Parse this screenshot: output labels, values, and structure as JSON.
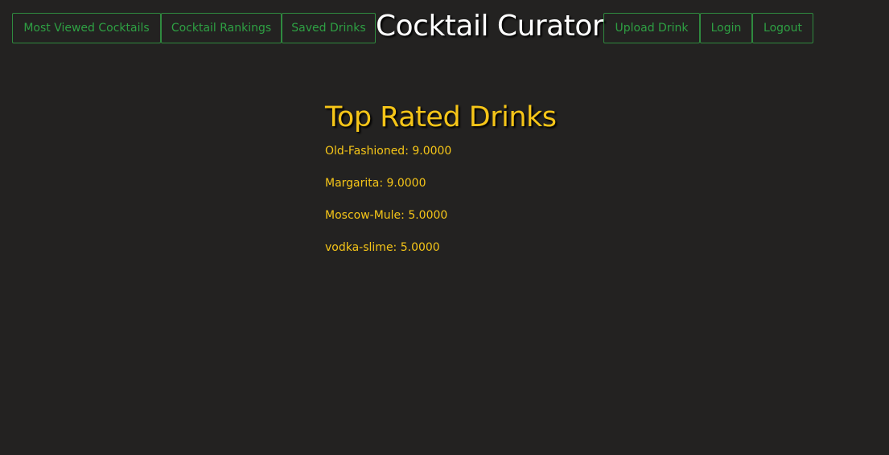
{
  "nav": {
    "most_viewed_label": "Most Viewed Cocktails",
    "rankings_label": "Cocktail Rankings",
    "saved_label": "Saved Drinks",
    "brand_title": "Cocktail Curator",
    "upload_label": "Upload Drink",
    "login_label": "Login",
    "logout_label": "Logout"
  },
  "main": {
    "title": "Top Rated Drinks",
    "drinks": [
      {
        "text": "Old-Fashioned: 9.0000"
      },
      {
        "text": "Margarita: 9.0000"
      },
      {
        "text": "Moscow-Mule: 5.0000"
      },
      {
        "text": "vodka-slime: 5.0000"
      }
    ]
  },
  "colors": {
    "background": "#232221",
    "nav_accent": "#2ea043",
    "heading_text": "#f5c518",
    "brand_text": "#ffffff"
  }
}
